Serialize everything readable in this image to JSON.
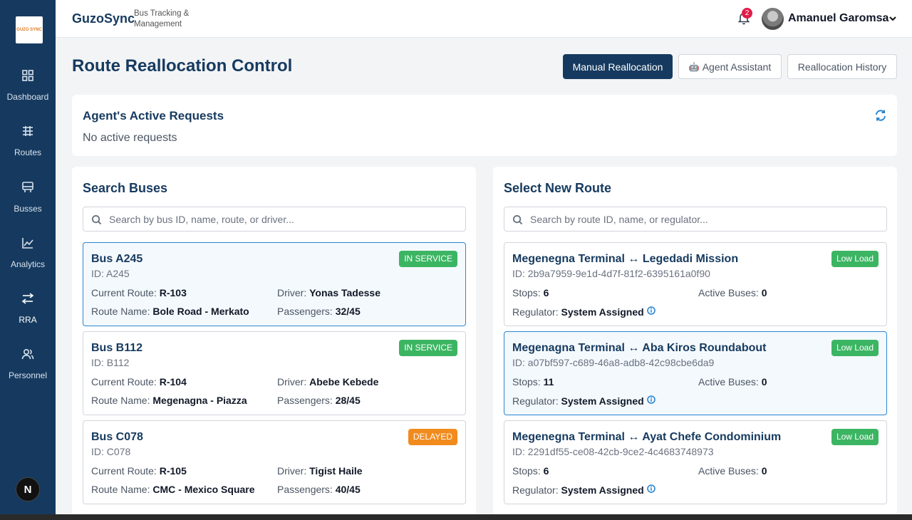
{
  "brand": {
    "name": "GuzoSync",
    "subtitle": "Bus Tracking & Management",
    "logo_text": "GUZO SYNC"
  },
  "sidebar": {
    "items": [
      {
        "label": "Dashboard",
        "icon": "grid-icon"
      },
      {
        "label": "Routes",
        "icon": "routes-icon"
      },
      {
        "label": "Busses",
        "icon": "bus-icon"
      },
      {
        "label": "Analytics",
        "icon": "chart-icon"
      },
      {
        "label": "RRA",
        "icon": "transfer-icon",
        "active": true
      },
      {
        "label": "Personnel",
        "icon": "users-icon"
      }
    ],
    "footer_badge": "N"
  },
  "header": {
    "notification_count": "2",
    "user_name": "Amanuel Garomsa"
  },
  "page": {
    "title": "Route Reallocation Control",
    "buttons": {
      "manual": "Manual Reallocation",
      "agent": "Agent Assistant",
      "history": "Reallocation History"
    }
  },
  "requests": {
    "title": "Agent's Active Requests",
    "empty": "No active requests"
  },
  "buses": {
    "title": "Search Buses",
    "placeholder": "Search by bus ID, name, route, or driver...",
    "labels": {
      "current_route": "Current Route:",
      "driver": "Driver:",
      "route_name": "Route Name:",
      "passengers": "Passengers:"
    },
    "items": [
      {
        "name": "Bus A245",
        "id": "ID: A245",
        "status": "IN SERVICE",
        "route": "R-103",
        "driver": "Yonas Tadesse",
        "route_name": "Bole Road - Merkato",
        "passengers": "32/45"
      },
      {
        "name": "Bus B112",
        "id": "ID: B112",
        "status": "IN SERVICE",
        "route": "R-104",
        "driver": "Abebe Kebede",
        "route_name": "Megenagna - Piazza",
        "passengers": "28/45"
      },
      {
        "name": "Bus C078",
        "id": "ID: C078",
        "status": "DELAYED",
        "route": "R-105",
        "driver": "Tigist Haile",
        "route_name": "CMC - Mexico Square",
        "passengers": "40/45"
      }
    ]
  },
  "routes": {
    "title": "Select New Route",
    "placeholder": "Search by route ID, name, or regulator...",
    "labels": {
      "stops": "Stops:",
      "active_buses": "Active Buses:",
      "regulator": "Regulator:"
    },
    "items": [
      {
        "name": "Megenegna Terminal ↔ Legedadi Mission",
        "id": "ID: 2b9a7959-9e1d-4d7f-81f2-6395161a0f90",
        "load": "Low Load",
        "stops": "6",
        "active_buses": "0",
        "regulator": "System Assigned"
      },
      {
        "name": "Megenagna Terminal ↔ Aba Kiros Roundabout",
        "id": "ID: a07bf597-c689-46a8-adb8-42c98cbe6da9",
        "load": "Low Load",
        "stops": "11",
        "active_buses": "0",
        "regulator": "System Assigned"
      },
      {
        "name": "Megenegna Terminal ↔ Ayat Chefe Condominium",
        "id": "ID: 2291df55-ce08-42cb-9ce2-4c4683748973",
        "load": "Low Load",
        "stops": "6",
        "active_buses": "0",
        "regulator": "System Assigned"
      }
    ]
  },
  "colors": {
    "primary": "#163a5f",
    "accent": "#2a86d1",
    "in_service": "#3cb563",
    "delayed": "#f28b1e"
  }
}
